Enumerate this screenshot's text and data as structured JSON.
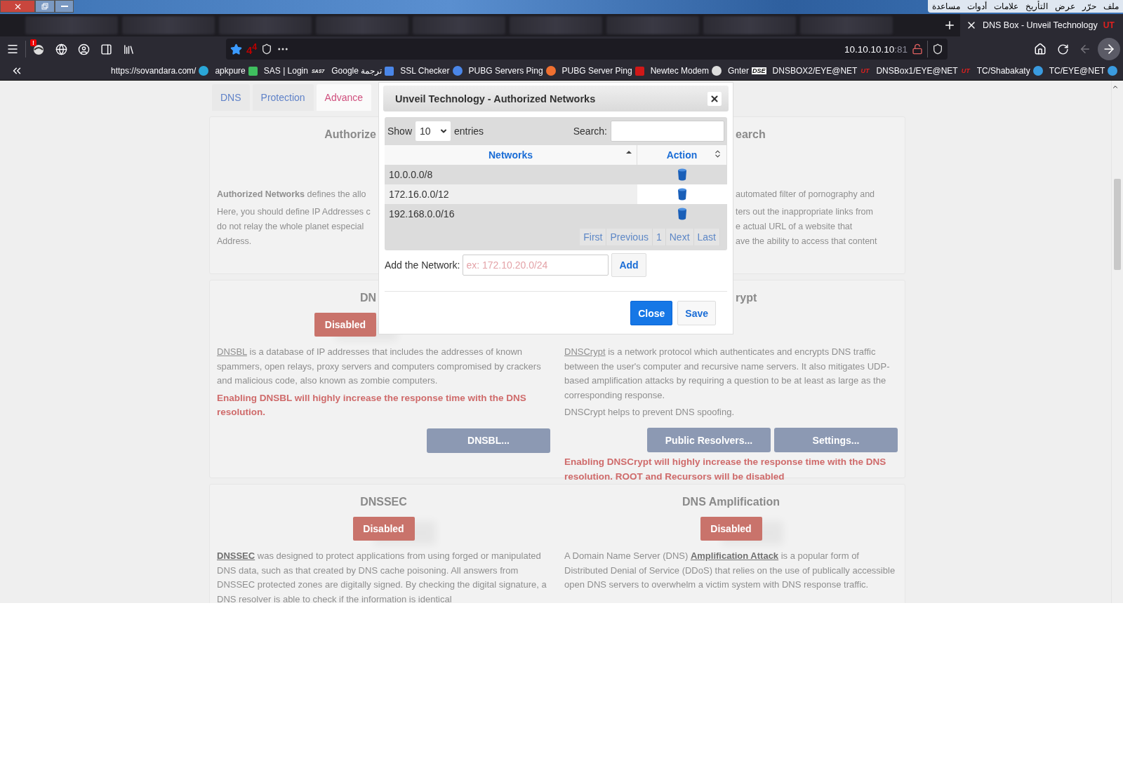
{
  "menu_bar": [
    "ملف",
    "حرّر",
    "عرض",
    "التأريخ",
    "علامات",
    "أدوات",
    "مساعدة"
  ],
  "active_tab": {
    "title": "DNS Box - Unveil Technology",
    "logo": "UT"
  },
  "toolbar": {
    "alert_badge": "!",
    "counter": "4$^{4}$",
    "url_host": "10.10.10.10",
    "url_port": ":81"
  },
  "bookmarks": [
    {
      "label": "https://sovandara.com/",
      "kind": "dot",
      "color": "#2aa7d8"
    },
    {
      "label": "apkpure",
      "kind": "tile",
      "color": "#3fbf5f"
    },
    {
      "label": "SAS | Login",
      "kind": "logo",
      "logo": "SAS7"
    },
    {
      "label": "Google ترجمة",
      "kind": "tile",
      "color": "#4a86e8"
    },
    {
      "label": "SSL Checker",
      "kind": "dot",
      "color": "#4a86e8"
    },
    {
      "label": "PUBG Servers Ping",
      "kind": "dot",
      "color": "#f07030"
    },
    {
      "label": "PUBG Server Ping",
      "kind": "tile",
      "color": "#d01818"
    },
    {
      "label": "Newtec Modem",
      "kind": "dot",
      "color": "#dddddd"
    },
    {
      "label": "Gnter",
      "kind": "logo",
      "logo": "DSE"
    },
    {
      "label": "DNSBOX2/EYE@NET",
      "kind": "logo",
      "logo": "UT"
    },
    {
      "label": "DNSBox1/EYE@NET",
      "kind": "logo",
      "logo": "UT"
    },
    {
      "label": "TC/Shabakaty",
      "kind": "dot",
      "color": "#3a9be0"
    },
    {
      "label": "TC/EYE@NET",
      "kind": "dot",
      "color": "#3a9be0"
    }
  ],
  "page_tabs": [
    {
      "label": "DNS",
      "selected": false
    },
    {
      "label": "Protection",
      "selected": false
    },
    {
      "label": "Advance",
      "selected": true
    }
  ],
  "cards": [
    {
      "columns": [
        {
          "heading": "Authorize",
          "blocks": [
            {
              "kind": "lines",
              "paragraphs": [
                [
                  "**Authorized Networks** defines the allo"
                ],
                [
                  "Here, you should define IP Addresses c",
                  "do not relay the whole planet especial",
                  "Address."
                ]
              ]
            }
          ]
        },
        {
          "heading": "earch",
          "blocks": [
            {
              "kind": "lines",
              "paragraphs": [
                [
                  "automated filter of pornography and"
                ],
                [
                  "ters out the inappropriate links from",
                  "e actual URL of a website that",
                  "ave the ability to access that content"
                ]
              ]
            }
          ]
        }
      ]
    },
    {
      "columns": [
        {
          "heading": "DN",
          "blocks": [
            {
              "kind": "switch",
              "label": "Disabled",
              "on": false
            },
            {
              "kind": "description",
              "link": "DNSBL",
              "after": " is a database of IP addresses that includes the addresses of known spammers, open relays, proxy servers and computers compromised by crackers and malicious code, also known as zombie computers.",
              "strong": false
            },
            {
              "kind": "warning",
              "text": "Enabling DNSBL will highly increase the response time with the DNS resolution."
            },
            {
              "kind": "buttons",
              "labels": [
                "DNSBL..."
              ]
            }
          ]
        },
        {
          "heading": "rypt",
          "blocks": [
            {
              "kind": "description",
              "link": "DNSCrypt",
              "after": " is a network protocol which authenticates and encrypts DNS traffic between the user's computer and recursive name servers. It also mitigates UDP-based amplification attacks by requiring a question to be at least as large as the corresponding response.",
              "strong": false
            },
            {
              "kind": "note",
              "text": "DNSCrypt helps to prevent DNS spoofing."
            },
            {
              "kind": "buttons",
              "labels": [
                "Public Resolvers...",
                "Settings..."
              ]
            },
            {
              "kind": "warning",
              "text": "Enabling DNSCrypt will highly increase the response time with the DNS resolution. ROOT and Recursors will be disabled"
            }
          ]
        }
      ]
    },
    {
      "columns": [
        {
          "heading": "DNSSEC",
          "blocks": [
            {
              "kind": "switch",
              "label": "Disabled",
              "on": false
            },
            {
              "kind": "description",
              "link": "DNSSEC",
              "after": " was designed to protect applications from using forged or manipulated DNS data, such as that created by DNS cache poisoning. All answers from DNSSEC protected zones are digitally signed. By checking the digital signature, a DNS resolver is able to check if the information is identical",
              "strong": true
            }
          ]
        },
        {
          "heading": "DNS Amplification",
          "blocks": [
            {
              "kind": "switch",
              "label": "Disabled",
              "on": false
            },
            {
              "kind": "description",
              "before": "A Domain Name Server (DNS) ",
              "link": "Amplification Attack",
              "after": " is a popular form of Distributed Denial of Service (DDoS) that relies on the use of publically accessible open DNS servers to overwhelm a victim system with DNS response traffic.",
              "strong": true
            }
          ]
        }
      ]
    }
  ],
  "modal": {
    "title": "Unveil Technology - Authorized Networks",
    "show_label": "Show",
    "page_size": "10",
    "entries_label": "entries",
    "search_label": "Search:",
    "columns": [
      {
        "label": "Networks",
        "sorted": true
      },
      {
        "label": "Action",
        "sorted": false
      }
    ],
    "rows": [
      {
        "network": "10.0.0.0/8"
      },
      {
        "network": "172.16.0.0/12"
      },
      {
        "network": "192.168.0.0/16"
      }
    ],
    "pagination": [
      {
        "label": "First",
        "disabled": true
      },
      {
        "label": "Previous",
        "disabled": true
      },
      {
        "label": "1",
        "disabled": true
      },
      {
        "label": "Next",
        "disabled": true
      },
      {
        "label": "Last",
        "disabled": true
      }
    ],
    "add_label": "Add the Network:",
    "add_placeholder": "ex: 172.10.20.0/24",
    "add_button": "Add",
    "buttons": [
      {
        "label": "Close",
        "kind": "primary"
      },
      {
        "label": "Save",
        "kind": "default"
      }
    ]
  }
}
